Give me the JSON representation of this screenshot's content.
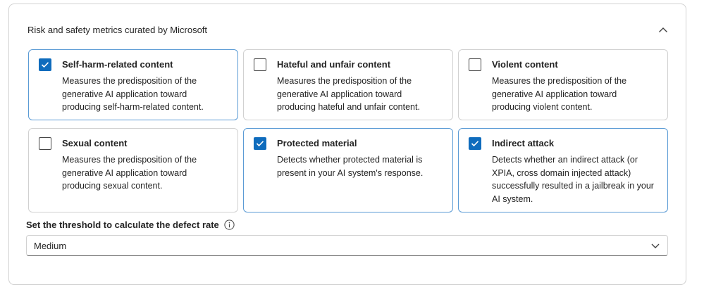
{
  "section": {
    "title": "Risk and safety metrics curated by Microsoft"
  },
  "metrics": [
    {
      "title": "Self-harm-related content",
      "description": "Measures the predisposition of the generative AI application toward producing self-harm-related content.",
      "checked": true
    },
    {
      "title": "Hateful and unfair content",
      "description": "Measures the predisposition of the generative AI application toward producing hateful and unfair content.",
      "checked": false
    },
    {
      "title": "Violent content",
      "description": "Measures the predisposition of the generative AI application toward producing violent content.",
      "checked": false
    },
    {
      "title": "Sexual content",
      "description": "Measures the predisposition of the generative AI application toward producing sexual content.",
      "checked": false
    },
    {
      "title": "Protected material",
      "description": "Detects whether protected material is present in your AI system's response.",
      "checked": true
    },
    {
      "title": "Indirect attack",
      "description": "Detects whether an indirect attack (or XPIA, cross domain injected attack) successfully resulted in a jailbreak in your AI system.",
      "checked": true
    }
  ],
  "threshold": {
    "label": "Set the threshold to calculate the defect rate",
    "selected": "Medium"
  },
  "colors": {
    "accent": "#0f6cbd",
    "checked_border": "#5b9bd5"
  },
  "icons": {
    "collapse": "chevron-up-icon",
    "info": "info-icon",
    "dropdown": "chevron-down-icon",
    "check": "checkmark-icon"
  }
}
